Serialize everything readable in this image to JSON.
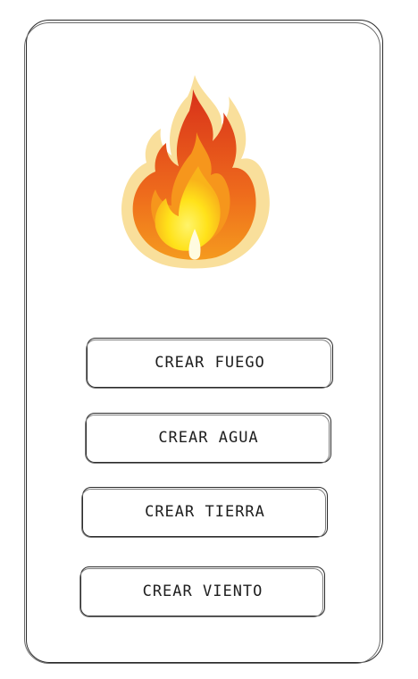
{
  "hero": {
    "icon": "fire-icon",
    "colors": {
      "outer": "#f7c96a",
      "mid": "#e8491c",
      "inner": "#f7a21b",
      "core": "#ffe81a"
    }
  },
  "buttons": [
    {
      "label": "CREAR FUEGO"
    },
    {
      "label": "CREAR AGUA"
    },
    {
      "label": "CREAR TIERRA"
    },
    {
      "label": "CREAR VIENTO"
    }
  ]
}
